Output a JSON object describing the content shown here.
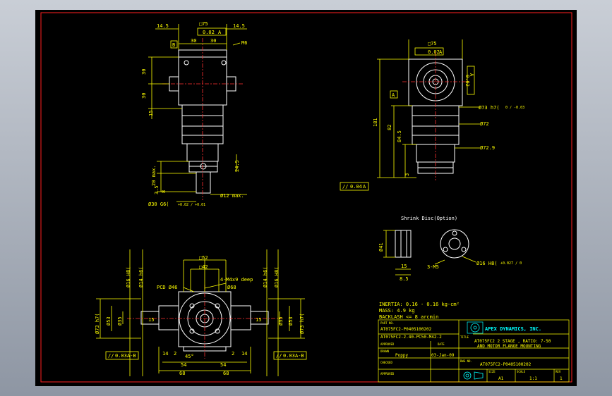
{
  "drawing": {
    "colors": {
      "background": "#000000",
      "border": "#ff2020",
      "geometry": "#ffffff",
      "dimension": "#ffff00",
      "text": "#00ffff",
      "hidden": "#ff3030"
    },
    "top_view": {
      "dim_14_5_left": "14.5",
      "sq_75": "□75",
      "flat_tol": "0.02",
      "datum_a": "A",
      "dim_14_5_right": "14.5",
      "datum_b": "B",
      "dim_30_a": "30",
      "dim_30_b": "30",
      "m6": "M6",
      "v_30_a": "30",
      "v_30_b": "30",
      "v_15": "15",
      "v_20_max": "20 max.",
      "v_3_5": "3.5",
      "v_8": "8",
      "v_24_5": "24.5",
      "shaft_dia": "Ø12 max.",
      "bottom_dia": "Ø30 G6(",
      "bottom_tol": "+0.02 / +0.01"
    },
    "side_view": {
      "sq_75": "□75",
      "flat_tol": "0.02",
      "datum_a": "A",
      "flat_tol_r": "0.02",
      "datum_a_r": "A",
      "v_181": "181",
      "v_82": "82",
      "v_84_5": "84.5",
      "v_3": "3",
      "datum_a_left": "A",
      "d_73": "Ø73 h7(",
      "d_73_tol": "0 / -0.03",
      "d_72": "Ø72",
      "d_72_9": "Ø72.9",
      "par_tol": "0.04",
      "par_datum": "A"
    },
    "shrink": {
      "title": "Shrink Disc(Option)",
      "v_41": "Ø41",
      "h_15": "15",
      "h_8_5": "8.5",
      "m5": "3-M5",
      "d_16": "Ø16 H8(",
      "d_16_tol": "+0.027 / 0"
    },
    "front_view": {
      "sq_52": "□52",
      "sq_42": "□42",
      "m4": "4-M4x9 deep",
      "pcd": "PCD Ø46",
      "d_68": "Ø68",
      "l_d16": "Ø16 H8(",
      "l_d14": "Ø14 h6(",
      "r_d14": "Ø14 h6(",
      "r_d16": "Ø16 H8(",
      "l_d73": "Ø73 h7(",
      "l_d53": "Ø53",
      "l_d35": "Ø35",
      "l_15": "15",
      "r_15": "15",
      "r_d35": "Ø35",
      "r_d53": "Ø53",
      "r_d73": "Ø73 h7(",
      "a45": "45°",
      "v_14_l": "14",
      "v_2_l": "2",
      "v_14_r": "14",
      "v_2_r": "2",
      "h_54_l": "54",
      "h_54_r": "54",
      "h_68_l": "68",
      "h_68_r": "68",
      "tol_l": "0.03",
      "datum_l": "A-B",
      "tol_r": "0.03",
      "datum_r": "A-B"
    },
    "specs": {
      "inertia": "INERTIA: 0.16 - 0.16  kg-cm²",
      "mass": "MASS: 4.9 kg",
      "backlash": "BACKLASH <= 8 arcmin",
      "part_no_label": "PART NO.",
      "part1": "AT075FC2-P0405100202",
      "part2": "AT075FC2-2.40-PC50-M42-2"
    },
    "title_block": {
      "company": "APEX DYNAMICS, INC.",
      "title_label": "TITLE",
      "title1": "AT075FC2 2 STAGE , RATIO: 7-50",
      "title2": "AND MOTOR FLANGE MOUNTING",
      "approved_label": "APPROVED",
      "date_label": "DATE",
      "drawn_label": "DRAWN",
      "drawn_by": "Poppy",
      "drawn_date": "03-Jan-09",
      "dwg_label": "DWG NO.",
      "dwg_no": "AT075FC2-P0405100202",
      "checked_label": "CHECKED",
      "size_label": "SIZE",
      "size": "A1",
      "scale_label": "SCALE",
      "scale": "1:1",
      "rev_label": "REV",
      "rev": "1",
      "approved2_label": "APPROVED"
    }
  }
}
